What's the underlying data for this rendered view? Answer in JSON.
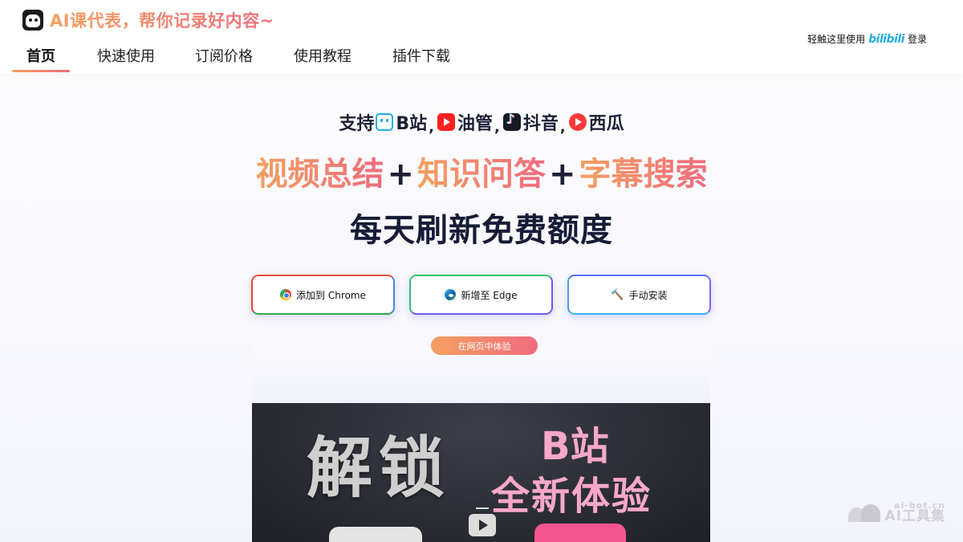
{
  "header": {
    "brand_title": "AI课代表，帮你记录好内容~",
    "nav": [
      {
        "label": "首页",
        "active": true
      },
      {
        "label": "快速使用",
        "active": false
      },
      {
        "label": "订阅价格",
        "active": false
      },
      {
        "label": "使用教程",
        "active": false
      },
      {
        "label": "插件下载",
        "active": false
      }
    ],
    "login_prefix": "轻触这里使用",
    "login_brand": "bilibili",
    "login_suffix": "登录"
  },
  "hero": {
    "support_label": "支持",
    "platforms": [
      {
        "name": "B站",
        "icon": "bilibili-icon"
      },
      {
        "name": "油管",
        "icon": "youtube-icon"
      },
      {
        "name": "抖音",
        "icon": "douyin-icon"
      },
      {
        "name": "西瓜",
        "icon": "xigua-icon"
      }
    ],
    "separator": ",",
    "features": [
      "视频总结",
      "知识问答",
      "字幕搜索"
    ],
    "plus": "+",
    "daily": "每天刷新免费额度"
  },
  "buttons": {
    "chrome": "添加到 Chrome",
    "edge": "新增至 Edge",
    "manual": "手动安装",
    "try_web": "在网页中体验"
  },
  "video": {
    "text_unlock": "解锁",
    "text_b": "B站",
    "text_new": "全新体验"
  },
  "watermark": {
    "domain": "ai-bot.cn",
    "name": "AI工具集"
  },
  "colors": {
    "accent_start": "#f5a060",
    "accent_end": "#ef6b7e",
    "dark_text": "#1c2036",
    "bilibili_blue": "#23ade5"
  }
}
